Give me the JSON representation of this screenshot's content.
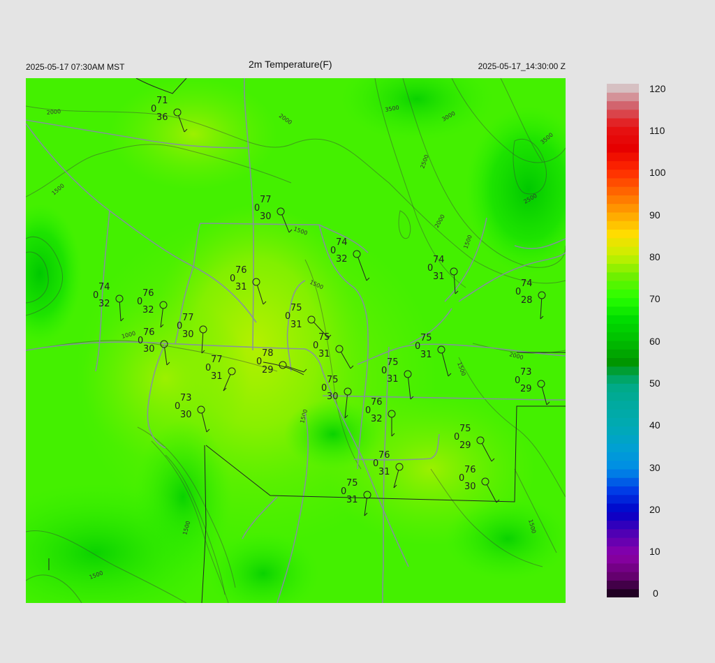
{
  "header": {
    "local_time": "2025-05-17 07:30AM MST",
    "title": "2m Temperature(F)",
    "utc_time": "2025-05-17_14:30:00 Z"
  },
  "colorbar": {
    "labels": [
      "120",
      "110",
      "100",
      "90",
      "80",
      "70",
      "60",
      "50",
      "40",
      "30",
      "20",
      "10",
      "0"
    ],
    "min": 0,
    "max": 120
  },
  "contour_labels": [
    "2000",
    "3500",
    "3000",
    "3500",
    "2000",
    "2500",
    "2000",
    "2500",
    "1500",
    "1500",
    "1500",
    "1000",
    "1500",
    "1500",
    "2000",
    "1500",
    "1500",
    "1500",
    "1500"
  ],
  "stations": [
    {
      "temp": "71",
      "mid": "0",
      "dew": "36"
    },
    {
      "temp": "77",
      "mid": "0",
      "dew": "30"
    },
    {
      "temp": "74",
      "mid": "0",
      "dew": "32"
    },
    {
      "temp": "74",
      "mid": "0",
      "dew": "31"
    },
    {
      "temp": "74",
      "mid": "0",
      "dew": "28"
    },
    {
      "temp": "76",
      "mid": "0",
      "dew": "31"
    },
    {
      "temp": "74",
      "mid": "0",
      "dew": "32"
    },
    {
      "temp": "76",
      "mid": "0",
      "dew": "32"
    },
    {
      "temp": "77",
      "mid": "0",
      "dew": "30"
    },
    {
      "temp": "76",
      "mid": "0",
      "dew": "30"
    },
    {
      "temp": "75",
      "mid": "0",
      "dew": "31"
    },
    {
      "temp": "75",
      "mid": "0",
      "dew": "31"
    },
    {
      "temp": "78",
      "mid": "0",
      "dew": "29"
    },
    {
      "temp": "77",
      "mid": "0",
      "dew": "31"
    },
    {
      "temp": "75",
      "mid": "0",
      "dew": "31"
    },
    {
      "temp": "75",
      "mid": "0",
      "dew": "31"
    },
    {
      "temp": "73",
      "mid": "0",
      "dew": "29"
    },
    {
      "temp": "75",
      "mid": "0",
      "dew": "30"
    },
    {
      "temp": "76",
      "mid": "0",
      "dew": "32"
    },
    {
      "temp": "73",
      "mid": "0",
      "dew": "30"
    },
    {
      "temp": "75",
      "mid": "0",
      "dew": "29"
    },
    {
      "temp": "76",
      "mid": "0",
      "dew": "31"
    },
    {
      "temp": "76",
      "mid": "0",
      "dew": "30"
    },
    {
      "temp": "75",
      "mid": "0",
      "dew": "31"
    }
  ]
}
